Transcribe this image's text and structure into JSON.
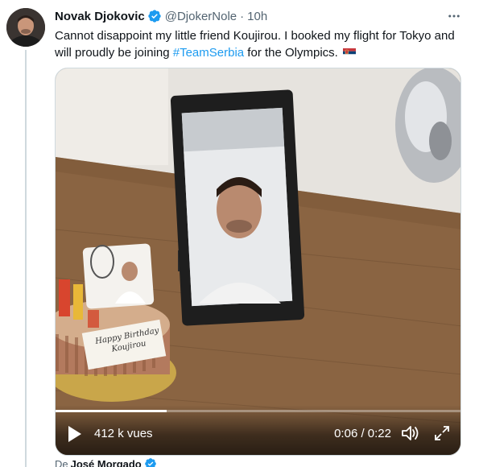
{
  "tweet": {
    "author_name": "Novak Djokovic",
    "handle": "@DjokerNole",
    "separator": "·",
    "time": "10h",
    "text_before": "Cannot disappoint my little friend Koujirou. I booked my flight for Tokyo and will proudly be joining ",
    "hashtag": "#TeamSerbia",
    "text_after": " for the Olympics.",
    "flag_icon": "serbia-flag-icon",
    "verified_color": "#1d9bf0"
  },
  "video": {
    "views": "412 k vues",
    "time_readout": "0:06 / 0:22",
    "progress": 0.2727,
    "cake_text_line1": "Happy Birthday",
    "cake_text_line2": "Koujirou"
  },
  "attribution": {
    "prefix": "De",
    "name": "José Morgado"
  },
  "colors": {
    "accent": "#1d9bf0",
    "secondary_text": "#536471",
    "border": "#cfd9de"
  }
}
